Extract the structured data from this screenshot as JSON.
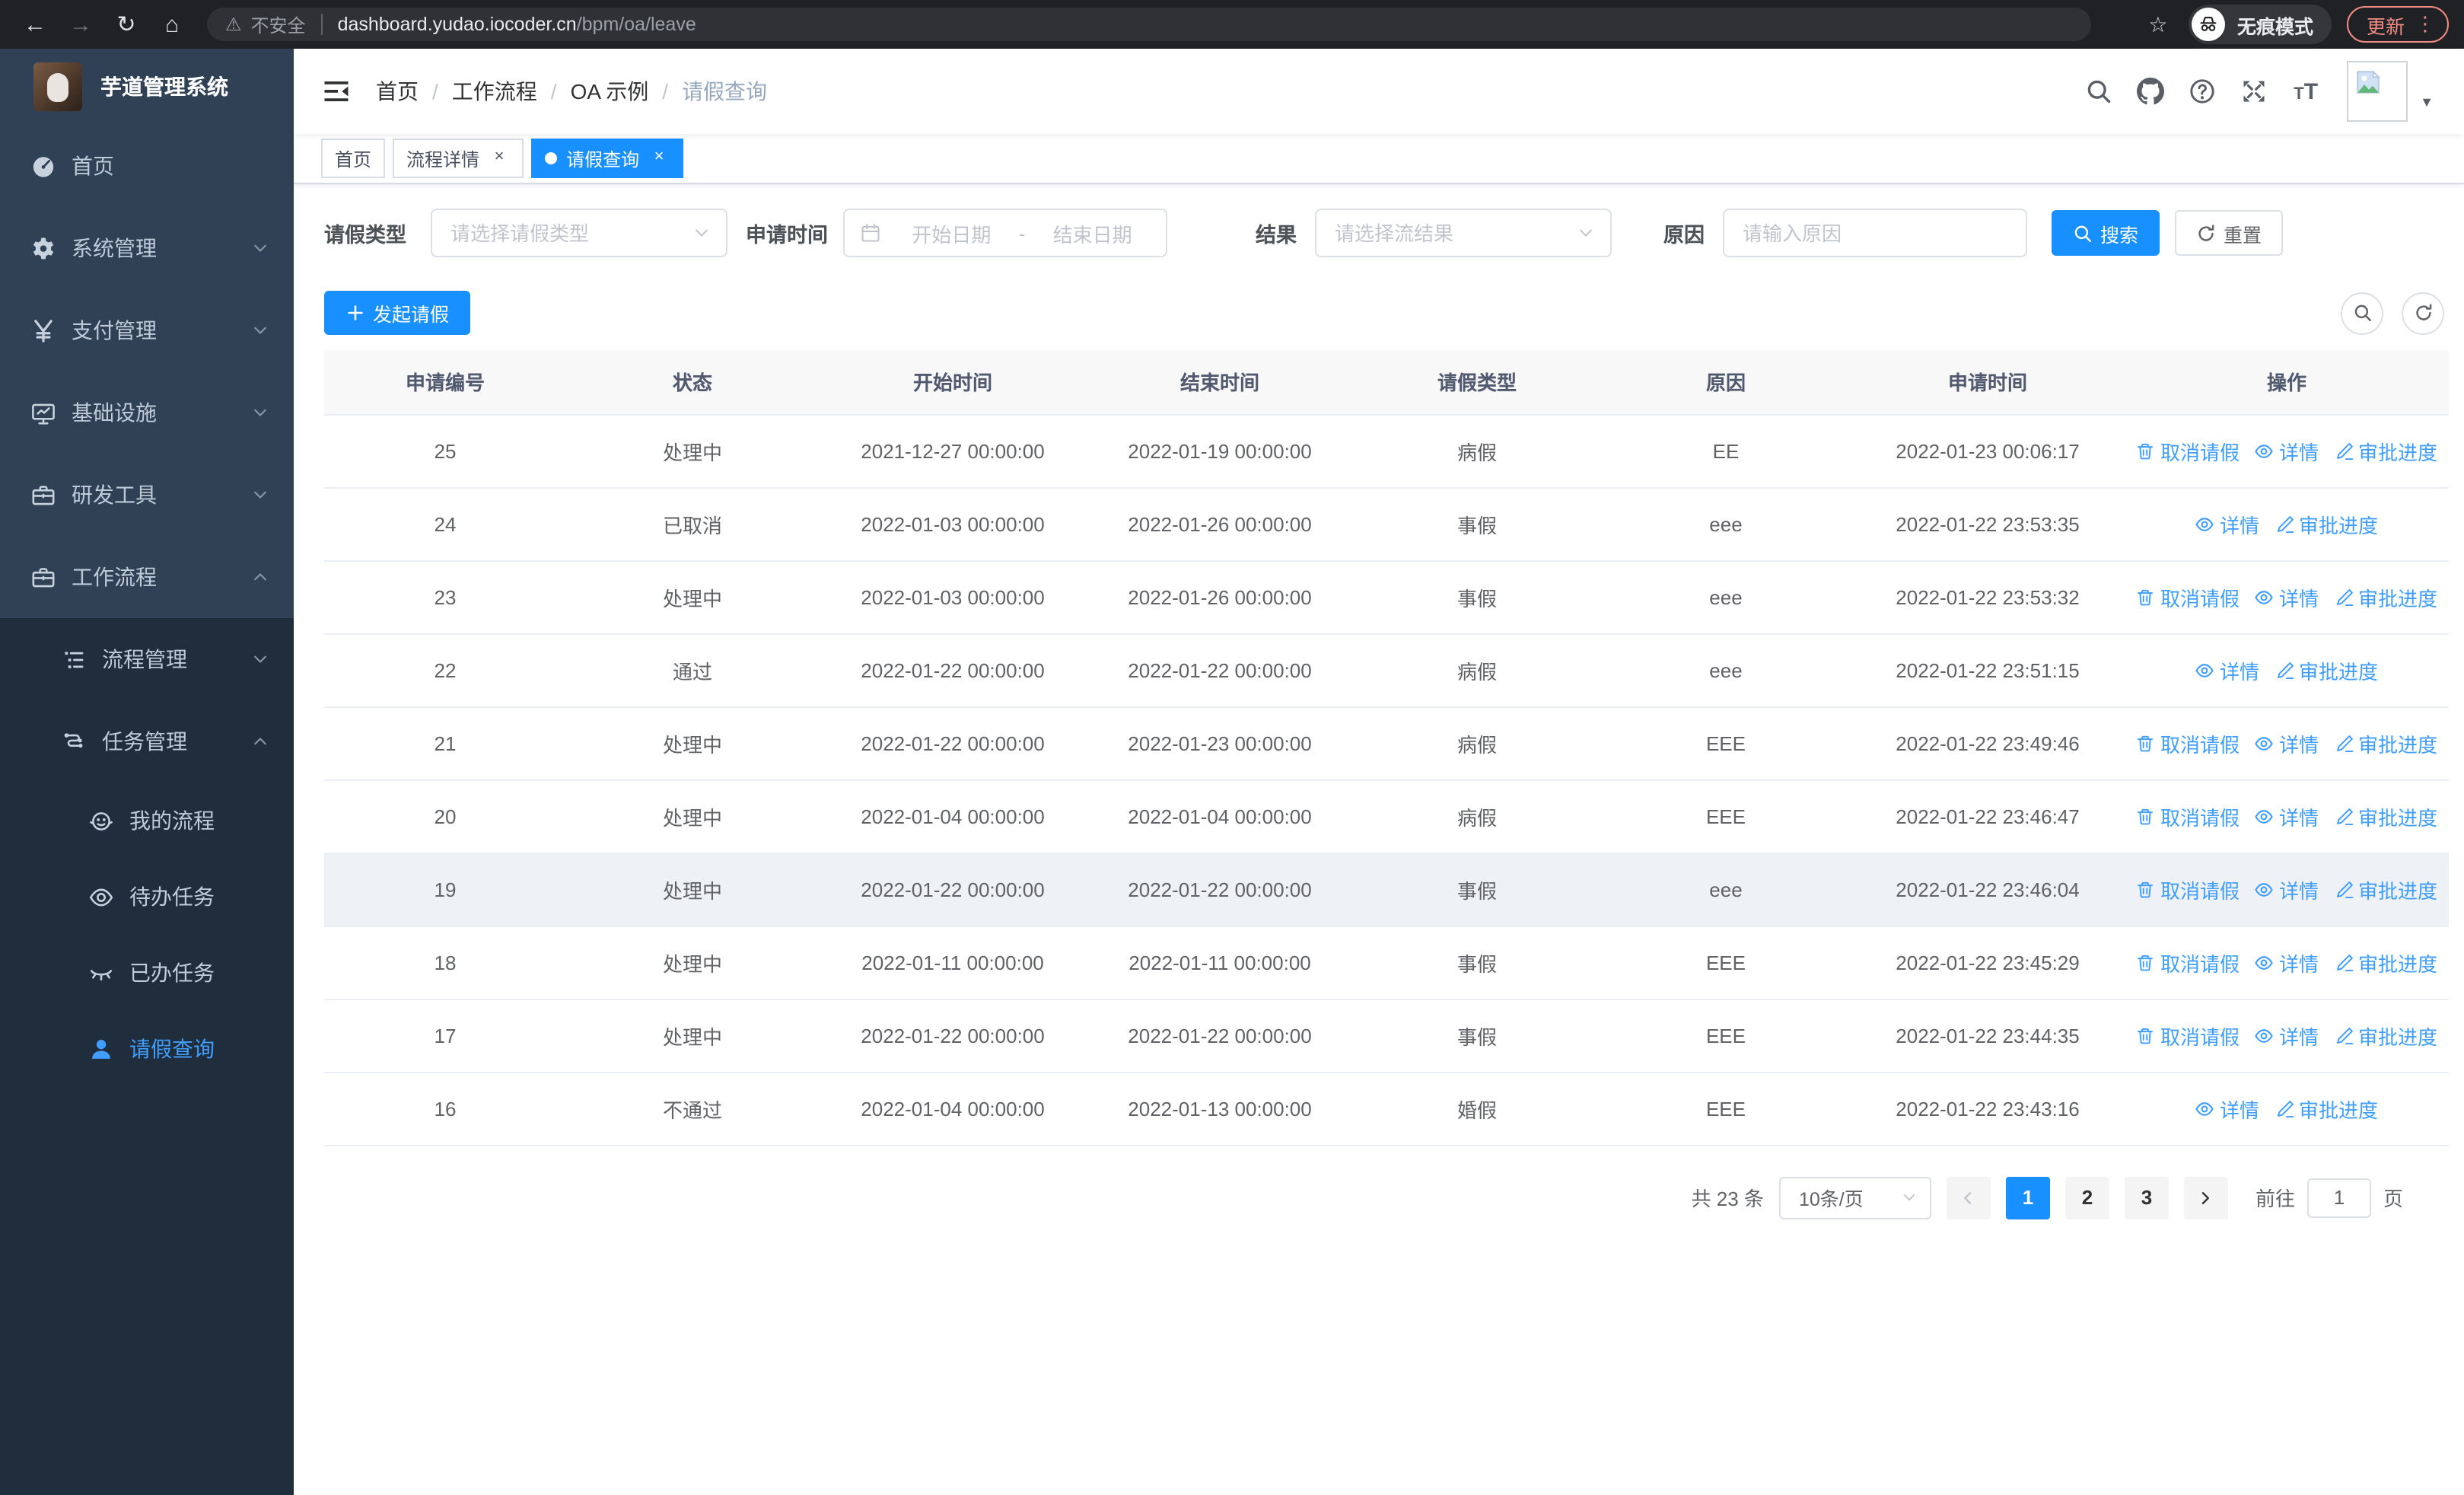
{
  "icons": {
    "back": "←",
    "forward": "→",
    "reload": "↻",
    "home": "⌂",
    "star": "☆",
    "more": "⋮",
    "warning": "⚠",
    "caret": "▼",
    "close": "×"
  },
  "browser": {
    "security_label": "不安全",
    "url_host": "dashboard.yudao.iocoder.cn",
    "url_path": "/bpm/oa/leave",
    "incognito_label": "无痕模式",
    "update_label": "更新"
  },
  "sidebar": {
    "title": "芋道管理系统",
    "items": [
      {
        "key": "home",
        "label": "首页",
        "icon": "dashboard",
        "level": 1
      },
      {
        "key": "system",
        "label": "系统管理",
        "icon": "gear",
        "level": 1,
        "chevron": "down"
      },
      {
        "key": "payment",
        "label": "支付管理",
        "icon": "yen",
        "level": 1,
        "chevron": "down"
      },
      {
        "key": "infra",
        "label": "基础设施",
        "icon": "monitor",
        "level": 1,
        "chevron": "down"
      },
      {
        "key": "devtools",
        "label": "研发工具",
        "icon": "briefcase",
        "level": 1,
        "chevron": "down"
      },
      {
        "key": "workflow",
        "label": "工作流程",
        "icon": "briefcase",
        "level": 1,
        "chevron": "up"
      },
      {
        "key": "process-mgmt",
        "label": "流程管理",
        "icon": "list",
        "level": 2,
        "chevron": "down"
      },
      {
        "key": "task-mgmt",
        "label": "任务管理",
        "icon": "tree",
        "level": 2,
        "chevron": "up"
      },
      {
        "key": "my-process",
        "label": "我的流程",
        "icon": "face",
        "level": 3
      },
      {
        "key": "todo-tasks",
        "label": "待办任务",
        "icon": "eye-open",
        "level": 3
      },
      {
        "key": "done-tasks",
        "label": "已办任务",
        "icon": "eye-closed",
        "level": 3
      },
      {
        "key": "leave-query",
        "label": "请假查询",
        "icon": "user",
        "level": 3,
        "active": true
      }
    ]
  },
  "header": {
    "breadcrumb": [
      "首页",
      "工作流程",
      "OA 示例",
      "请假查询"
    ]
  },
  "tabs": [
    {
      "key": "home",
      "label": "首页",
      "closable": false,
      "active": false
    },
    {
      "key": "process-detail",
      "label": "流程详情",
      "closable": true,
      "active": false
    },
    {
      "key": "leave-query",
      "label": "请假查询",
      "closable": true,
      "active": true
    }
  ],
  "filters": {
    "leave_type_label": "请假类型",
    "leave_type_placeholder": "请选择请假类型",
    "apply_time_label": "申请时间",
    "date_start_placeholder": "开始日期",
    "date_separator": "-",
    "date_end_placeholder": "结束日期",
    "result_label": "结果",
    "result_placeholder": "请选择流结果",
    "reason_label": "原因",
    "reason_placeholder": "请输入原因",
    "search_label": "搜索",
    "reset_label": "重置"
  },
  "toolbar": {
    "create_label": "发起请假"
  },
  "table": {
    "columns": [
      "申请编号",
      "状态",
      "开始时间",
      "结束时间",
      "请假类型",
      "原因",
      "申请时间",
      "操作"
    ],
    "column_keys": [
      "id",
      "status",
      "start-time",
      "end-time",
      "leave-type",
      "reason",
      "apply-time"
    ],
    "action_labels": {
      "cancel": "取消请假",
      "detail": "详情",
      "progress": "审批进度"
    },
    "action_icons": {
      "cancel": "trash",
      "detail": "eye",
      "progress": "pen"
    },
    "rows": [
      {
        "id": "25",
        "status": "处理中",
        "start_time": "2021-12-27 00:00:00",
        "end_time": "2022-01-19 00:00:00",
        "leave_type": "病假",
        "reason": "EE",
        "apply_time": "2022-01-23 00:06:17",
        "actions": [
          "cancel",
          "detail",
          "progress"
        ]
      },
      {
        "id": "24",
        "status": "已取消",
        "start_time": "2022-01-03 00:00:00",
        "end_time": "2022-01-26 00:00:00",
        "leave_type": "事假",
        "reason": "eee",
        "apply_time": "2022-01-22 23:53:35",
        "actions": [
          "detail",
          "progress"
        ]
      },
      {
        "id": "23",
        "status": "处理中",
        "start_time": "2022-01-03 00:00:00",
        "end_time": "2022-01-26 00:00:00",
        "leave_type": "事假",
        "reason": "eee",
        "apply_time": "2022-01-22 23:53:32",
        "actions": [
          "cancel",
          "detail",
          "progress"
        ]
      },
      {
        "id": "22",
        "status": "通过",
        "start_time": "2022-01-22 00:00:00",
        "end_time": "2022-01-22 00:00:00",
        "leave_type": "病假",
        "reason": "eee",
        "apply_time": "2022-01-22 23:51:15",
        "actions": [
          "detail",
          "progress"
        ]
      },
      {
        "id": "21",
        "status": "处理中",
        "start_time": "2022-01-22 00:00:00",
        "end_time": "2022-01-23 00:00:00",
        "leave_type": "病假",
        "reason": "EEE",
        "apply_time": "2022-01-22 23:49:46",
        "actions": [
          "cancel",
          "detail",
          "progress"
        ]
      },
      {
        "id": "20",
        "status": "处理中",
        "start_time": "2022-01-04 00:00:00",
        "end_time": "2022-01-04 00:00:00",
        "leave_type": "病假",
        "reason": "EEE",
        "apply_time": "2022-01-22 23:46:47",
        "actions": [
          "cancel",
          "detail",
          "progress"
        ]
      },
      {
        "id": "19",
        "status": "处理中",
        "start_time": "2022-01-22 00:00:00",
        "end_time": "2022-01-22 00:00:00",
        "leave_type": "事假",
        "reason": "eee",
        "apply_time": "2022-01-22 23:46:04",
        "actions": [
          "cancel",
          "detail",
          "progress"
        ],
        "highlighted": true
      },
      {
        "id": "18",
        "status": "处理中",
        "start_time": "2022-01-11 00:00:00",
        "end_time": "2022-01-11 00:00:00",
        "leave_type": "事假",
        "reason": "EEE",
        "apply_time": "2022-01-22 23:45:29",
        "actions": [
          "cancel",
          "detail",
          "progress"
        ]
      },
      {
        "id": "17",
        "status": "处理中",
        "start_time": "2022-01-22 00:00:00",
        "end_time": "2022-01-22 00:00:00",
        "leave_type": "事假",
        "reason": "EEE",
        "apply_time": "2022-01-22 23:44:35",
        "actions": [
          "cancel",
          "detail",
          "progress"
        ]
      },
      {
        "id": "16",
        "status": "不通过",
        "start_time": "2022-01-04 00:00:00",
        "end_time": "2022-01-13 00:00:00",
        "leave_type": "婚假",
        "reason": "EEE",
        "apply_time": "2022-01-22 23:43:16",
        "actions": [
          "detail",
          "progress"
        ]
      }
    ]
  },
  "pagination": {
    "total_label": "共 23 条",
    "page_size": "10条/页",
    "pages": [
      "1",
      "2",
      "3"
    ],
    "active_page": "1",
    "goto_label": "前往",
    "goto_value": "1",
    "page_suffix_label": "页"
  },
  "colors": {
    "primary": "#1890ff",
    "link": "#409eff",
    "sidebar_bg": "#304156",
    "sidebar_sub_bg": "#1f2d3d",
    "menu_active": "#409eff",
    "update_accent": "#f28b82"
  }
}
